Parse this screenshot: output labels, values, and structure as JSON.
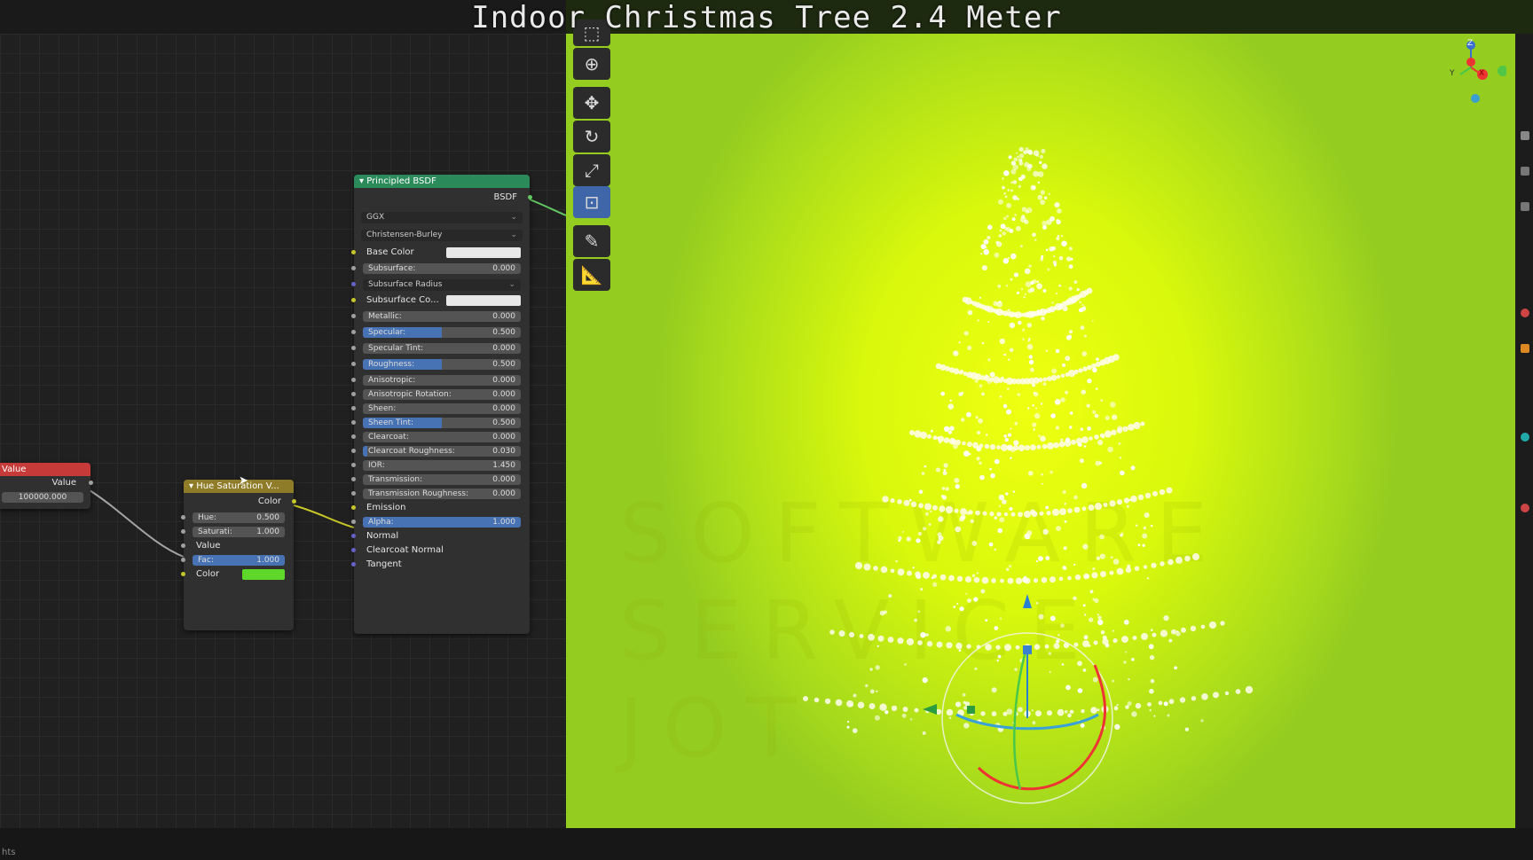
{
  "overlay_title": "Indoor Christmas Tree 2.4 Meter",
  "status_text": "hts",
  "nodes": {
    "value": {
      "title": "Value",
      "output": "Value",
      "field": "100000.000",
      "header_color": "#c73a3a"
    },
    "hue_sat": {
      "title": "Hue Saturation V...",
      "output": "Color",
      "hue_label": "Hue:",
      "hue_value": "0.500",
      "sat_label": "Saturati:",
      "sat_value": "1.000",
      "value_label": "Value",
      "fac_label": "Fac:",
      "fac_value": "1.000",
      "fac_fill": 1.0,
      "color_label": "Color",
      "color_swatch": "#5ed62a",
      "header_color": "#8f7c28"
    },
    "bsdf": {
      "title": "Principled BSDF",
      "output": "BSDF",
      "header_color": "#2a8a5a",
      "distribution": "GGX",
      "subsurface_method": "Christensen-Burley",
      "base_color_label": "Base Color",
      "subsurface_label": "Subsurface:",
      "subsurface_value": "0.000",
      "subsurface_radius_label": "Subsurface Radius",
      "subsurface_color_label": "Subsurface Co...",
      "metallic_label": "Metallic:",
      "metallic_value": "0.000",
      "specular_label": "Specular:",
      "specular_value": "0.500",
      "specular_fill": 0.5,
      "specular_tint_label": "Specular Tint:",
      "specular_tint_value": "0.000",
      "roughness_label": "Roughness:",
      "roughness_value": "0.500",
      "roughness_fill": 0.5,
      "anisotropic_label": "Anisotropic:",
      "anisotropic_value": "0.000",
      "aniso_rot_label": "Anisotropic Rotation:",
      "aniso_rot_value": "0.000",
      "sheen_label": "Sheen:",
      "sheen_value": "0.000",
      "sheen_tint_label": "Sheen Tint:",
      "sheen_tint_value": "0.500",
      "sheen_tint_fill": 0.5,
      "clearcoat_label": "Clearcoat:",
      "clearcoat_value": "0.000",
      "cc_rough_label": "Clearcoat Roughness:",
      "cc_rough_value": "0.030",
      "cc_rough_fill": 0.03,
      "ior_label": "IOR:",
      "ior_value": "1.450",
      "transmission_label": "Transmission:",
      "transmission_value": "0.000",
      "trans_rough_label": "Transmission Roughness:",
      "trans_rough_value": "0.000",
      "emission_label": "Emission",
      "alpha_label": "Alpha:",
      "alpha_value": "1.000",
      "alpha_fill": 1.0,
      "normal_label": "Normal",
      "cc_normal_label": "Clearcoat Normal",
      "tangent_label": "Tangent"
    }
  },
  "tools": [
    {
      "icon": "select-box-icon",
      "glyph": "⬚"
    },
    {
      "icon": "cursor-icon",
      "glyph": "⊕"
    },
    {
      "icon": "move-icon",
      "glyph": "✥"
    },
    {
      "icon": "rotate-icon",
      "glyph": "↻"
    },
    {
      "icon": "scale-icon",
      "glyph": "⤢"
    },
    {
      "icon": "transform-icon",
      "glyph": "⊡"
    },
    {
      "icon": "annotate-icon",
      "glyph": "✎"
    },
    {
      "icon": "measure-icon",
      "glyph": "📐"
    }
  ],
  "gizmo": {
    "x_label": "X",
    "y_label": "Y",
    "z_label": "Z"
  },
  "watermark": [
    "SOFTWARE",
    "SERVICE",
    "JOT"
  ],
  "colors": {
    "viewport_green": "#d8f80c",
    "accent_blue": "#4772b3"
  }
}
